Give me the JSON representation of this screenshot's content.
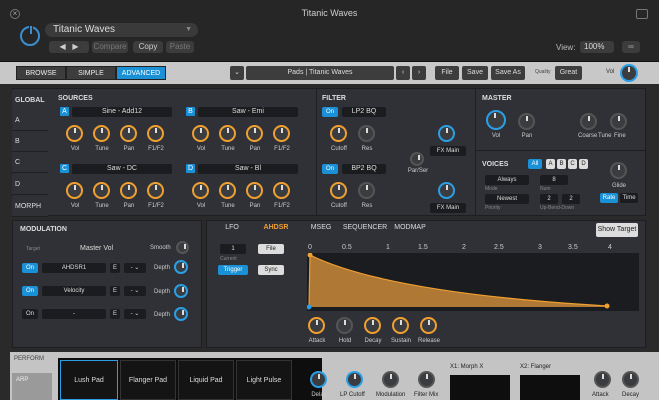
{
  "window": {
    "title": "Titanic Waves",
    "preset_name": "Titanic Waves",
    "compare": "Compare",
    "copy": "Copy",
    "paste": "Paste",
    "view_label": "View:",
    "zoom": "100%"
  },
  "modes": [
    "BROWSE",
    "SIMPLE",
    "ADVANCED"
  ],
  "toolbar": {
    "patch": "Pads | Titanic Waves",
    "file": "File",
    "save": "Save",
    "save_as": "Save As",
    "quality_label": "Quality",
    "quality": "Great",
    "vol_label": "Vol"
  },
  "sidebar": [
    "GLOBAL",
    "A",
    "B",
    "C",
    "D",
    "MORPH"
  ],
  "sources": {
    "title": "SOURCES",
    "oscs": [
      {
        "id": "A",
        "name": "Sine - Add12"
      },
      {
        "id": "B",
        "name": "Saw - Emi"
      },
      {
        "id": "C",
        "name": "Saw - DC"
      },
      {
        "id": "D",
        "name": "Saw - Bl"
      }
    ],
    "knobs": [
      "Vol",
      "Tune",
      "Pan",
      "F1/F2"
    ]
  },
  "filter": {
    "title": "FILTER",
    "on": "On",
    "f1": "LP2 BQ",
    "f2": "BP2 BQ",
    "knobs": [
      "Cutoff",
      "Res"
    ],
    "fx": "FX Main",
    "par": "Par/Ser"
  },
  "master": {
    "title": "MASTER",
    "knobs": [
      "Vol",
      "Pan",
      "Coarse",
      "Tune",
      "Fine"
    ]
  },
  "voices": {
    "title": "VOICES",
    "all": "All",
    "ids": [
      "A",
      "B",
      "C",
      "D"
    ],
    "mode": "Always",
    "mode_label": "Mode",
    "num": "8",
    "num_label": "Num",
    "prio": "Newest",
    "prio_label": "Priority",
    "updown": "2",
    "updown2": "2",
    "updown_label": "Up-Bend-Down",
    "glide": "Glide",
    "rate": "Rate",
    "time": "Time"
  },
  "modulation": {
    "title": "MODULATION",
    "target_label": "Target",
    "target": "Master Vol",
    "smooth": "Smooth",
    "rows": [
      {
        "on": "On",
        "src": "AHDSR1",
        "e": "E",
        "depth": "Depth"
      },
      {
        "on": "On",
        "src": "Velocity",
        "e": "E",
        "depth": "Depth"
      },
      {
        "on": "On",
        "src": "-",
        "e": "E",
        "depth": "Depth"
      }
    ]
  },
  "env": {
    "tabs": [
      "LFO",
      "AHDSR",
      "MSEG",
      "SEQUENCER",
      "MODMAP"
    ],
    "show_target": "Show Target",
    "num": "1",
    "current": "Current",
    "file": "File",
    "trigger": "Trigger",
    "sync": "Sync",
    "ruler": [
      "0",
      "0.5",
      "1",
      "1.5",
      "2",
      "2.5",
      "3",
      "3.5",
      "4"
    ],
    "knobs": [
      "Attack",
      "Hold",
      "Decay",
      "Sustain",
      "Release"
    ]
  },
  "perform": {
    "title": "PERFORM",
    "arp": "ARP",
    "pads": [
      "Lush Pad",
      "Flanger Pad",
      "Liquid Pad",
      "Light Pulse"
    ],
    "knobs": [
      "Delay",
      "LP Cutoff",
      "Modulation",
      "Filter Mix"
    ],
    "x1": "X1: Morph X",
    "x2": "X2: Flanger",
    "knobs2": [
      "Attack",
      "Decay"
    ]
  }
}
